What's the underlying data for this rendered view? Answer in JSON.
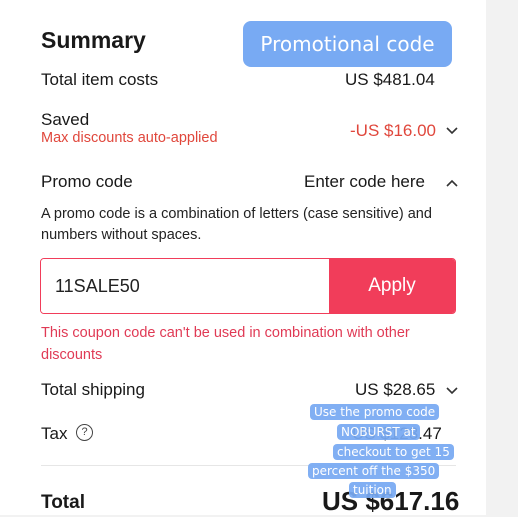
{
  "summary": {
    "title": "Summary",
    "total_item_costs_label": "Total item costs",
    "total_item_costs_value": "US $481.04",
    "saved_label": "Saved",
    "saved_note": "Max discounts auto-applied",
    "saved_value": "-US $16.00",
    "promo_label": "Promo code",
    "promo_toggle": "Enter code here",
    "promo_description": "A promo code is a combination of letters (case sensitive) and numbers without spaces.",
    "promo_input_value": "11SALE50",
    "apply_label": "Apply",
    "error_message": "This coupon code can't be used in combination with other discounts",
    "shipping_label": "Total shipping",
    "shipping_value": "US $28.65",
    "tax_label": "Tax",
    "tax_value": "US $123.47",
    "total_label": "Total",
    "total_value": "US $617.16"
  },
  "overlay": {
    "title": "Promotional code",
    "note_lines": [
      "Use the promo code",
      "NOBURST at",
      "checkout to get 15",
      "percent off the $350",
      "tuition"
    ]
  },
  "colors": {
    "accent": "#f13d5a",
    "saved_red": "#e0473c",
    "overlay_blue": "#78aaf3"
  },
  "icons": {
    "saved_chevron": "chevron-down-icon",
    "promo_chevron": "chevron-up-icon",
    "shipping_chevron": "chevron-down-icon",
    "tax_help": "question-circle-icon"
  }
}
